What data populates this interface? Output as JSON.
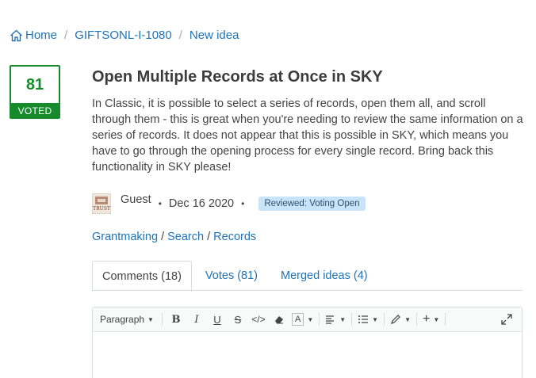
{
  "breadcrumb": {
    "home": "Home",
    "sep1": "/",
    "category": "GIFTSONL-I-1080",
    "sep2": "/",
    "current": "New idea"
  },
  "vote": {
    "count": "81",
    "label": "VOTED",
    "color": "#178a2b"
  },
  "idea": {
    "title": "Open Multiple Records at Once in SKY",
    "description": "In Classic, it is possible to select a series of records, open them all, and scroll through them - this is great when you're needing to review the same information on a series of records. It does not appear that this is possible in SKY, which means you have to go through the opening process for every single record. Bring back this functionality in SKY please!"
  },
  "meta": {
    "avatar_text": "TRUST",
    "user": "Guest",
    "dot": "•",
    "date": "Dec 16 2020",
    "status_badge": "Reviewed: Voting Open"
  },
  "categories": {
    "items": [
      "Grantmaking",
      "Search",
      "Records"
    ],
    "sep": "/"
  },
  "tabs": [
    {
      "label": "Comments (18)",
      "active": true
    },
    {
      "label": "Votes (81)",
      "active": false
    },
    {
      "label": "Merged ideas (4)",
      "active": false
    }
  ],
  "editor": {
    "paragraph_label": "Paragraph",
    "bold": "B",
    "italic": "I",
    "underline": "U",
    "strike": "S",
    "code": "</>",
    "font_color": "A",
    "insert": "+"
  },
  "colors": {
    "link": "#1f73b7",
    "badge_bg": "#c9e4f8"
  }
}
